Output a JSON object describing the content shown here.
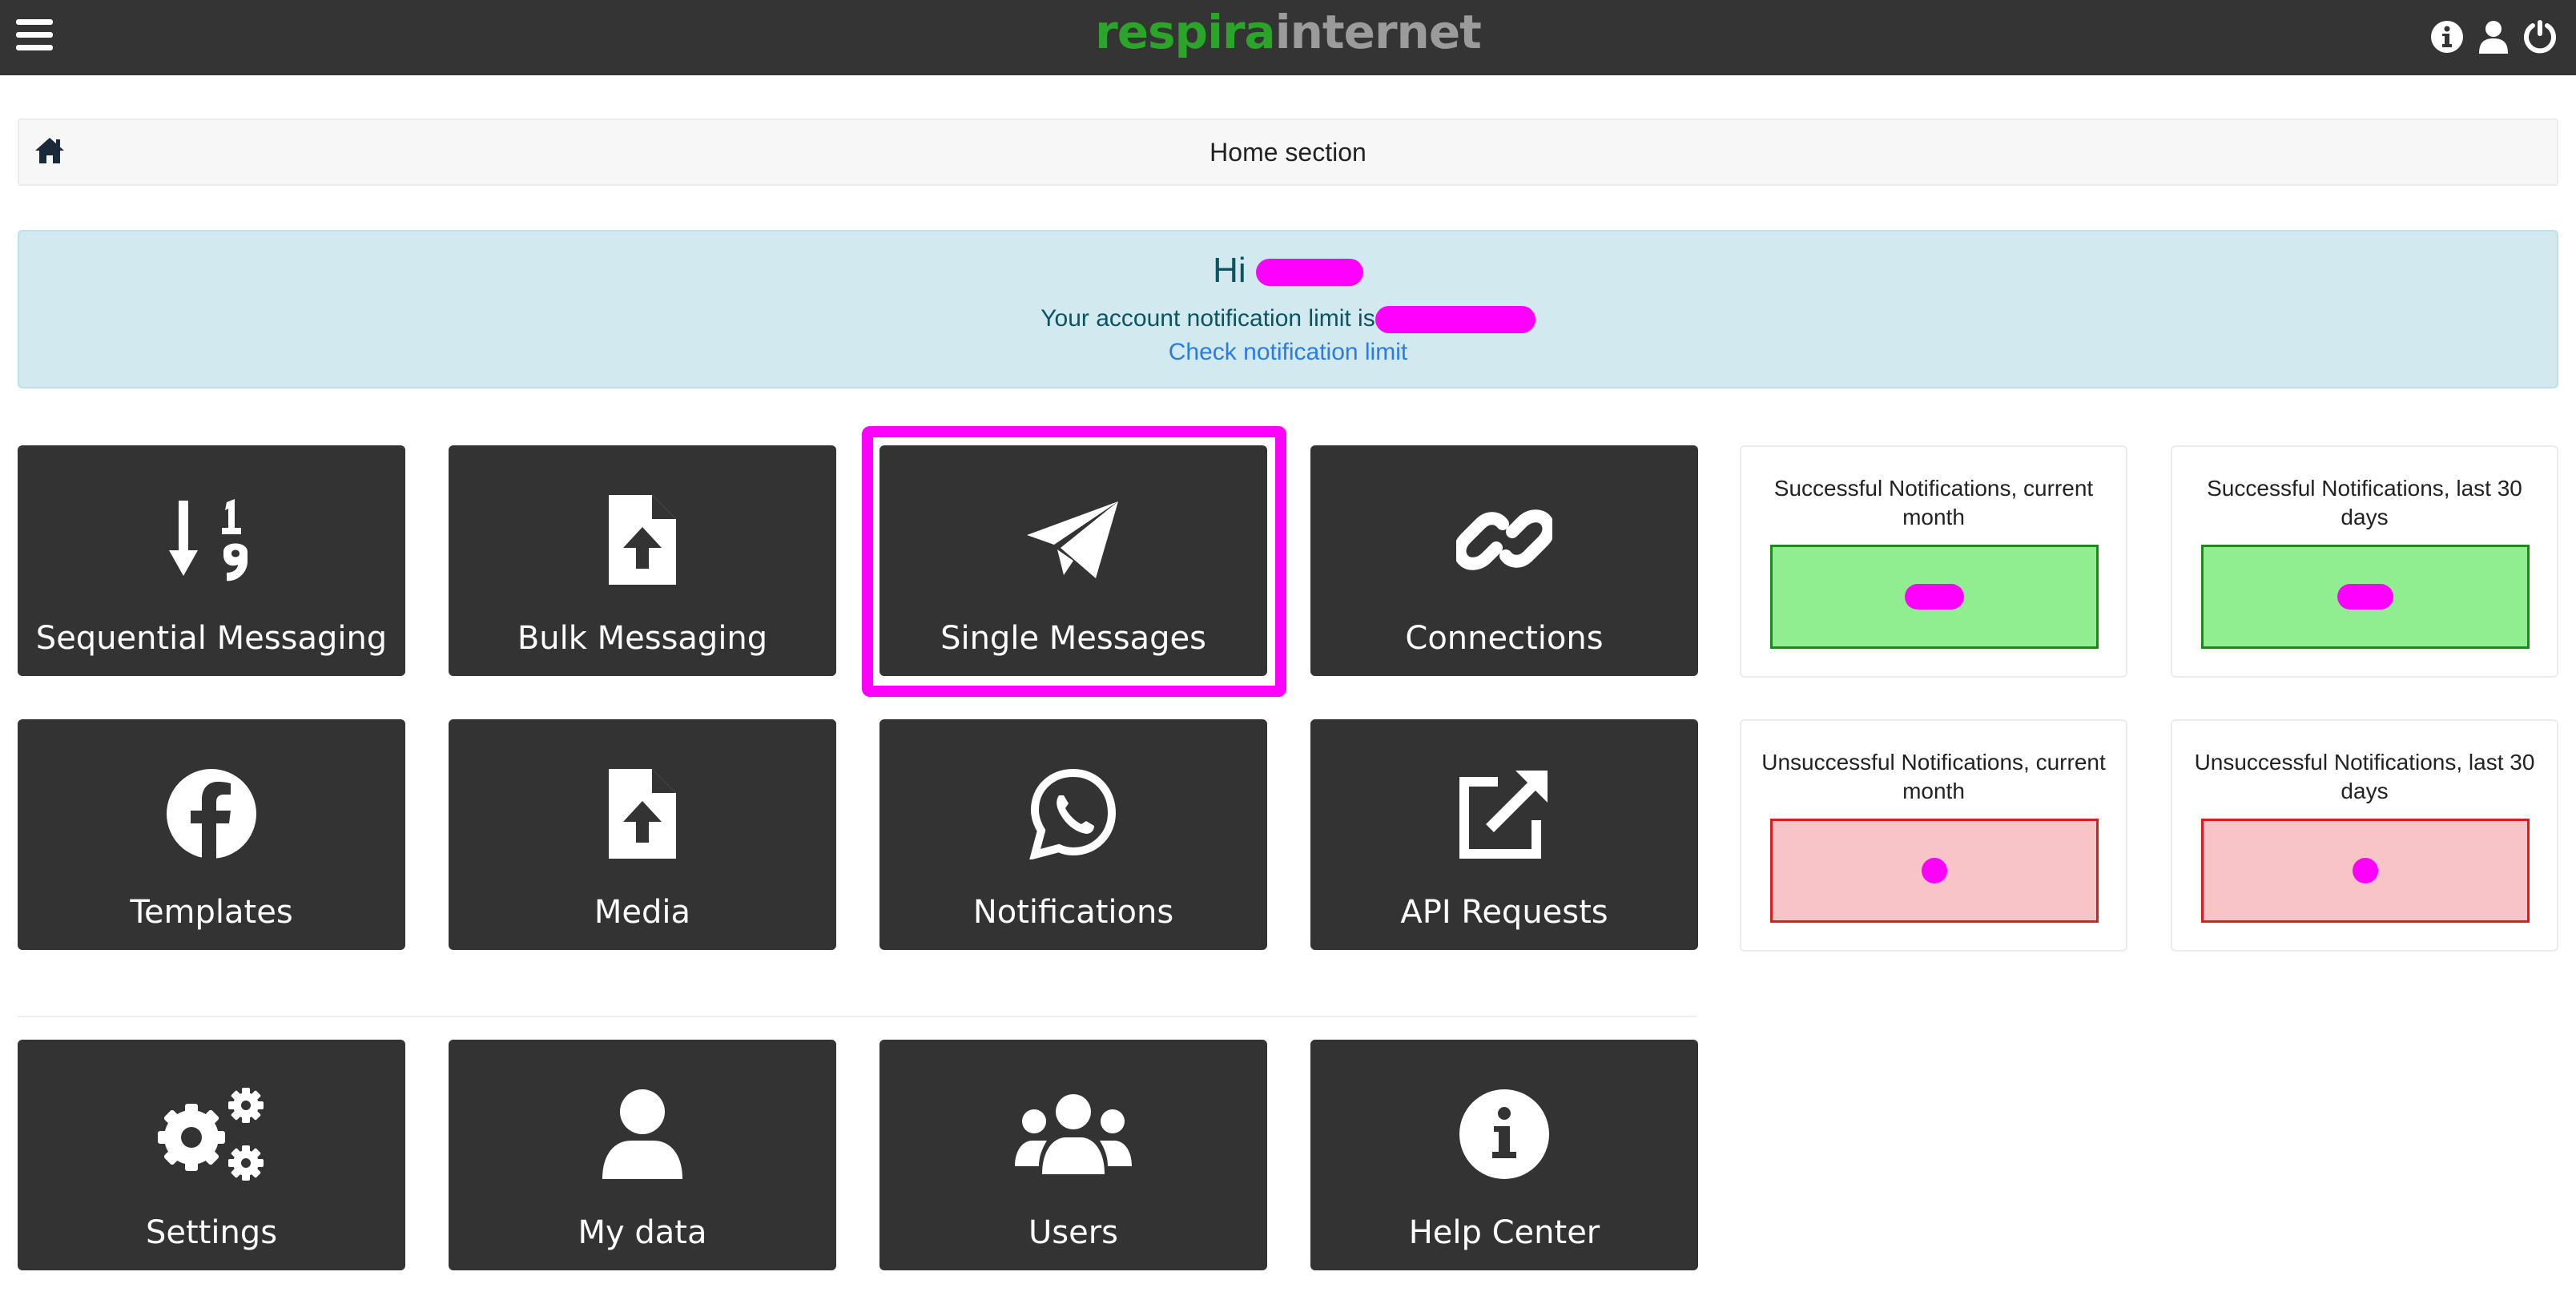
{
  "navbar": {
    "brand_part1": "respira",
    "brand_part2": "internet",
    "icons": [
      "info-icon",
      "user-icon",
      "power-icon"
    ]
  },
  "breadcrumb": {
    "title": "Home section"
  },
  "welcome": {
    "greeting": "Hi",
    "limit_text": "Your account notification limit is",
    "check_link": "Check notification limit"
  },
  "tiles": [
    {
      "label": "Sequential Messaging",
      "icon": "sort-numeric-icon"
    },
    {
      "label": "Bulk Messaging",
      "icon": "file-upload-icon"
    },
    {
      "label": "Single Messages",
      "icon": "paper-plane-icon"
    },
    {
      "label": "Connections",
      "icon": "link-icon"
    },
    {
      "label": "Templates",
      "icon": "facebook-icon"
    },
    {
      "label": "Media",
      "icon": "file-upload-icon"
    },
    {
      "label": "Notifications",
      "icon": "whatsapp-icon"
    },
    {
      "label": "API Requests",
      "icon": "external-link-icon"
    },
    {
      "label": "Settings",
      "icon": "gears-icon"
    },
    {
      "label": "My data",
      "icon": "user-icon"
    },
    {
      "label": "Users",
      "icon": "users-icon"
    },
    {
      "label": "Help Center",
      "icon": "info-circle-icon"
    }
  ],
  "stats": [
    {
      "title": "Successful Notifications, current month",
      "status": "success"
    },
    {
      "title": "Successful Notifications, last 30 days",
      "status": "success"
    },
    {
      "title": "Unsuccessful Notifications, current month",
      "status": "failure"
    },
    {
      "title": "Unsuccessful Notifications, last 30 days",
      "status": "failure"
    }
  ],
  "colors": {
    "navbar": "#343434",
    "brand_green": "#2aa52a",
    "brand_grey": "#9b9b9b",
    "tile": "#333333",
    "highlight": "#ff00ff",
    "alert_bg": "#d1e9ef",
    "success_bg": "#90ee90",
    "failure_bg": "#f8c4c8"
  }
}
